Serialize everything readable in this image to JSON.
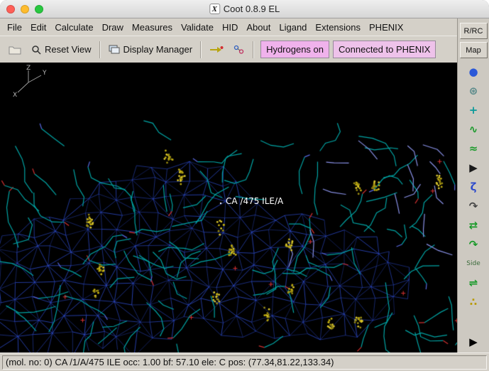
{
  "window": {
    "title": "Coot 0.8.9 EL",
    "app_icon_glyph": "X"
  },
  "menubar": {
    "items": [
      "File",
      "Edit",
      "Calculate",
      "Draw",
      "Measures",
      "Validate",
      "HID",
      "About",
      "Ligand",
      "Extensions",
      "PHENIX"
    ]
  },
  "toolbar": {
    "reset_view_label": "Reset View",
    "display_manager_label": "Display Manager",
    "hydrogens_label": "Hydrogens on",
    "phenix_label": "Connected to PHENIX"
  },
  "right_panel": {
    "rrc_label": "R/RC",
    "map_label": "Map",
    "overflow_glyph": "▶",
    "icons": [
      {
        "name": "refine-sphere-icon",
        "glyph": "●",
        "color": "#2a58d8"
      },
      {
        "name": "rotamer-dots-icon",
        "glyph": "⊛",
        "color": "#5a8a8a"
      },
      {
        "name": "anchor-crosshair-icon",
        "glyph": "+",
        "color": "#0a9a9a"
      },
      {
        "name": "real-space-refine-icon",
        "glyph": "∿",
        "color": "#1a9a2a"
      },
      {
        "name": "regularize-zone-icon",
        "glyph": "≈",
        "color": "#1a9a2a"
      },
      {
        "name": "expander-arrow-icon",
        "glyph": "▶",
        "color": "#1a1a1a"
      },
      {
        "name": "edit-chi-angles-icon",
        "glyph": "ζ",
        "color": "#2a48cc"
      },
      {
        "name": "torsion-general-icon",
        "glyph": "↷",
        "color": "#444444"
      },
      {
        "name": "flip-peptide-icon",
        "glyph": "⇄",
        "color": "#1a9a2a"
      },
      {
        "name": "jed-flip-icon",
        "glyph": "↷",
        "color": "#1a9a2a"
      },
      {
        "name": "side-chain-flip-icon",
        "glyph": "Side",
        "color": "#3a6a3a"
      },
      {
        "name": "mutate-residue-icon",
        "glyph": "⇌",
        "color": "#1a9a2a"
      },
      {
        "name": "add-alt-conf-icon",
        "glyph": "∴",
        "color": "#b89a00"
      }
    ]
  },
  "viewport": {
    "atom_label": "CA /475 ILE/A",
    "axes": {
      "x": "X",
      "y": "Y",
      "z": "Z"
    }
  },
  "statusbar": {
    "text": "(mol. no: 0)  CA /1/A/475 ILE occ:  1.00 bf: 57.10 ele:  C pos: (77.34,81.22,133.34)"
  },
  "colors": {
    "mesh_blue": "#3050d8",
    "model_teal": "#00a4a4",
    "dots_yellow": "#c2ae10",
    "oxygen_red": "#d23030",
    "nitrogen_blue": "#5868e0",
    "label_white": "#ffffff",
    "hydrogens_badge": "#f0b2ec",
    "phenix_badge": "#eec2ea",
    "close": "#ff5f57",
    "minimize": "#febc2e",
    "zoom": "#28c840"
  }
}
